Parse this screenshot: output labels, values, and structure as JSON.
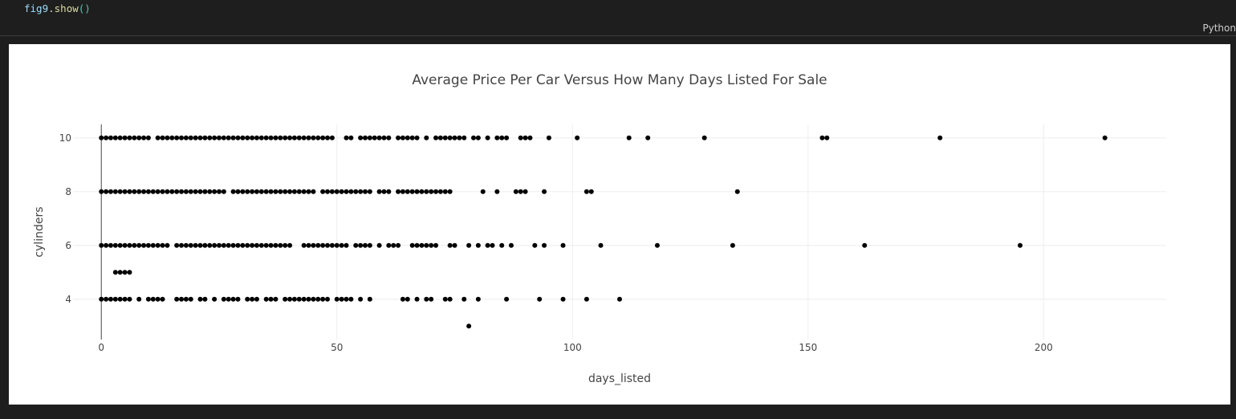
{
  "code": {
    "object": "fig9",
    "dot": ".",
    "method": "show",
    "parens": "()"
  },
  "cell": {
    "language_label": "Python"
  },
  "chart_data": {
    "type": "scatter",
    "title": "Average Price Per Car Versus How Many Days Listed For Sale",
    "xlabel": "days_listed",
    "ylabel": "cylinders",
    "xlim": [
      -6,
      226
    ],
    "ylim": [
      2.5,
      10.5
    ],
    "x_ticks": [
      0,
      50,
      100,
      150,
      200
    ],
    "y_ticks": [
      4,
      6,
      8,
      10
    ],
    "grid": true,
    "marker_color": "#000000",
    "series": [
      {
        "points": [
          [
            0,
            10
          ],
          [
            1,
            10
          ],
          [
            2,
            10
          ],
          [
            3,
            10
          ],
          [
            4,
            10
          ],
          [
            5,
            10
          ],
          [
            6,
            10
          ],
          [
            7,
            10
          ],
          [
            8,
            10
          ],
          [
            9,
            10
          ],
          [
            10,
            10
          ],
          [
            12,
            10
          ],
          [
            13,
            10
          ],
          [
            14,
            10
          ],
          [
            15,
            10
          ],
          [
            16,
            10
          ],
          [
            17,
            10
          ],
          [
            18,
            10
          ],
          [
            19,
            10
          ],
          [
            20,
            10
          ],
          [
            21,
            10
          ],
          [
            22,
            10
          ],
          [
            23,
            10
          ],
          [
            24,
            10
          ],
          [
            25,
            10
          ],
          [
            26,
            10
          ],
          [
            27,
            10
          ],
          [
            28,
            10
          ],
          [
            29,
            10
          ],
          [
            30,
            10
          ],
          [
            31,
            10
          ],
          [
            32,
            10
          ],
          [
            33,
            10
          ],
          [
            34,
            10
          ],
          [
            35,
            10
          ],
          [
            36,
            10
          ],
          [
            37,
            10
          ],
          [
            38,
            10
          ],
          [
            39,
            10
          ],
          [
            40,
            10
          ],
          [
            41,
            10
          ],
          [
            42,
            10
          ],
          [
            43,
            10
          ],
          [
            44,
            10
          ],
          [
            45,
            10
          ],
          [
            46,
            10
          ],
          [
            47,
            10
          ],
          [
            48,
            10
          ],
          [
            49,
            10
          ],
          [
            52,
            10
          ],
          [
            53,
            10
          ],
          [
            55,
            10
          ],
          [
            56,
            10
          ],
          [
            57,
            10
          ],
          [
            58,
            10
          ],
          [
            59,
            10
          ],
          [
            60,
            10
          ],
          [
            61,
            10
          ],
          [
            63,
            10
          ],
          [
            64,
            10
          ],
          [
            65,
            10
          ],
          [
            66,
            10
          ],
          [
            67,
            10
          ],
          [
            69,
            10
          ],
          [
            71,
            10
          ],
          [
            72,
            10
          ],
          [
            73,
            10
          ],
          [
            74,
            10
          ],
          [
            75,
            10
          ],
          [
            76,
            10
          ],
          [
            77,
            10
          ],
          [
            79,
            10
          ],
          [
            80,
            10
          ],
          [
            82,
            10
          ],
          [
            84,
            10
          ],
          [
            85,
            10
          ],
          [
            86,
            10
          ],
          [
            89,
            10
          ],
          [
            90,
            10
          ],
          [
            91,
            10
          ],
          [
            95,
            10
          ],
          [
            101,
            10
          ],
          [
            112,
            10
          ],
          [
            116,
            10
          ],
          [
            128,
            10
          ],
          [
            153,
            10
          ],
          [
            154,
            10
          ],
          [
            178,
            10
          ],
          [
            213,
            10
          ],
          [
            0,
            8
          ],
          [
            1,
            8
          ],
          [
            2,
            8
          ],
          [
            3,
            8
          ],
          [
            4,
            8
          ],
          [
            5,
            8
          ],
          [
            6,
            8
          ],
          [
            7,
            8
          ],
          [
            8,
            8
          ],
          [
            9,
            8
          ],
          [
            10,
            8
          ],
          [
            11,
            8
          ],
          [
            12,
            8
          ],
          [
            13,
            8
          ],
          [
            14,
            8
          ],
          [
            15,
            8
          ],
          [
            16,
            8
          ],
          [
            17,
            8
          ],
          [
            18,
            8
          ],
          [
            19,
            8
          ],
          [
            20,
            8
          ],
          [
            21,
            8
          ],
          [
            22,
            8
          ],
          [
            23,
            8
          ],
          [
            24,
            8
          ],
          [
            25,
            8
          ],
          [
            26,
            8
          ],
          [
            28,
            8
          ],
          [
            29,
            8
          ],
          [
            30,
            8
          ],
          [
            31,
            8
          ],
          [
            32,
            8
          ],
          [
            33,
            8
          ],
          [
            34,
            8
          ],
          [
            35,
            8
          ],
          [
            36,
            8
          ],
          [
            37,
            8
          ],
          [
            38,
            8
          ],
          [
            39,
            8
          ],
          [
            40,
            8
          ],
          [
            41,
            8
          ],
          [
            42,
            8
          ],
          [
            43,
            8
          ],
          [
            44,
            8
          ],
          [
            45,
            8
          ],
          [
            47,
            8
          ],
          [
            48,
            8
          ],
          [
            49,
            8
          ],
          [
            50,
            8
          ],
          [
            51,
            8
          ],
          [
            52,
            8
          ],
          [
            53,
            8
          ],
          [
            54,
            8
          ],
          [
            55,
            8
          ],
          [
            56,
            8
          ],
          [
            57,
            8
          ],
          [
            59,
            8
          ],
          [
            60,
            8
          ],
          [
            61,
            8
          ],
          [
            63,
            8
          ],
          [
            64,
            8
          ],
          [
            65,
            8
          ],
          [
            66,
            8
          ],
          [
            67,
            8
          ],
          [
            68,
            8
          ],
          [
            69,
            8
          ],
          [
            70,
            8
          ],
          [
            71,
            8
          ],
          [
            72,
            8
          ],
          [
            73,
            8
          ],
          [
            74,
            8
          ],
          [
            81,
            8
          ],
          [
            84,
            8
          ],
          [
            88,
            8
          ],
          [
            89,
            8
          ],
          [
            90,
            8
          ],
          [
            94,
            8
          ],
          [
            103,
            8
          ],
          [
            104,
            8
          ],
          [
            135,
            8
          ],
          [
            0,
            6
          ],
          [
            1,
            6
          ],
          [
            2,
            6
          ],
          [
            3,
            6
          ],
          [
            4,
            6
          ],
          [
            5,
            6
          ],
          [
            6,
            6
          ],
          [
            7,
            6
          ],
          [
            8,
            6
          ],
          [
            9,
            6
          ],
          [
            10,
            6
          ],
          [
            11,
            6
          ],
          [
            12,
            6
          ],
          [
            13,
            6
          ],
          [
            14,
            6
          ],
          [
            16,
            6
          ],
          [
            17,
            6
          ],
          [
            18,
            6
          ],
          [
            19,
            6
          ],
          [
            20,
            6
          ],
          [
            21,
            6
          ],
          [
            22,
            6
          ],
          [
            23,
            6
          ],
          [
            24,
            6
          ],
          [
            25,
            6
          ],
          [
            26,
            6
          ],
          [
            27,
            6
          ],
          [
            28,
            6
          ],
          [
            29,
            6
          ],
          [
            30,
            6
          ],
          [
            31,
            6
          ],
          [
            32,
            6
          ],
          [
            33,
            6
          ],
          [
            34,
            6
          ],
          [
            35,
            6
          ],
          [
            36,
            6
          ],
          [
            37,
            6
          ],
          [
            38,
            6
          ],
          [
            39,
            6
          ],
          [
            40,
            6
          ],
          [
            43,
            6
          ],
          [
            44,
            6
          ],
          [
            45,
            6
          ],
          [
            46,
            6
          ],
          [
            47,
            6
          ],
          [
            48,
            6
          ],
          [
            49,
            6
          ],
          [
            50,
            6
          ],
          [
            51,
            6
          ],
          [
            52,
            6
          ],
          [
            54,
            6
          ],
          [
            55,
            6
          ],
          [
            56,
            6
          ],
          [
            57,
            6
          ],
          [
            59,
            6
          ],
          [
            61,
            6
          ],
          [
            62,
            6
          ],
          [
            63,
            6
          ],
          [
            66,
            6
          ],
          [
            67,
            6
          ],
          [
            68,
            6
          ],
          [
            69,
            6
          ],
          [
            70,
            6
          ],
          [
            71,
            6
          ],
          [
            74,
            6
          ],
          [
            75,
            6
          ],
          [
            78,
            6
          ],
          [
            80,
            6
          ],
          [
            82,
            6
          ],
          [
            83,
            6
          ],
          [
            85,
            6
          ],
          [
            87,
            6
          ],
          [
            92,
            6
          ],
          [
            94,
            6
          ],
          [
            98,
            6
          ],
          [
            106,
            6
          ],
          [
            118,
            6
          ],
          [
            134,
            6
          ],
          [
            162,
            6
          ],
          [
            195,
            6
          ],
          [
            3,
            5
          ],
          [
            4,
            5
          ],
          [
            5,
            5
          ],
          [
            6,
            5
          ],
          [
            0,
            4
          ],
          [
            1,
            4
          ],
          [
            2,
            4
          ],
          [
            3,
            4
          ],
          [
            4,
            4
          ],
          [
            5,
            4
          ],
          [
            6,
            4
          ],
          [
            8,
            4
          ],
          [
            10,
            4
          ],
          [
            11,
            4
          ],
          [
            12,
            4
          ],
          [
            13,
            4
          ],
          [
            16,
            4
          ],
          [
            17,
            4
          ],
          [
            18,
            4
          ],
          [
            19,
            4
          ],
          [
            21,
            4
          ],
          [
            22,
            4
          ],
          [
            24,
            4
          ],
          [
            26,
            4
          ],
          [
            27,
            4
          ],
          [
            28,
            4
          ],
          [
            29,
            4
          ],
          [
            31,
            4
          ],
          [
            32,
            4
          ],
          [
            33,
            4
          ],
          [
            35,
            4
          ],
          [
            36,
            4
          ],
          [
            37,
            4
          ],
          [
            39,
            4
          ],
          [
            40,
            4
          ],
          [
            41,
            4
          ],
          [
            42,
            4
          ],
          [
            43,
            4
          ],
          [
            44,
            4
          ],
          [
            45,
            4
          ],
          [
            46,
            4
          ],
          [
            47,
            4
          ],
          [
            48,
            4
          ],
          [
            50,
            4
          ],
          [
            51,
            4
          ],
          [
            52,
            4
          ],
          [
            53,
            4
          ],
          [
            55,
            4
          ],
          [
            57,
            4
          ],
          [
            64,
            4
          ],
          [
            65,
            4
          ],
          [
            67,
            4
          ],
          [
            69,
            4
          ],
          [
            70,
            4
          ],
          [
            73,
            4
          ],
          [
            74,
            4
          ],
          [
            77,
            4
          ],
          [
            80,
            4
          ],
          [
            86,
            4
          ],
          [
            93,
            4
          ],
          [
            98,
            4
          ],
          [
            103,
            4
          ],
          [
            110,
            4
          ],
          [
            78,
            3
          ]
        ]
      }
    ]
  }
}
